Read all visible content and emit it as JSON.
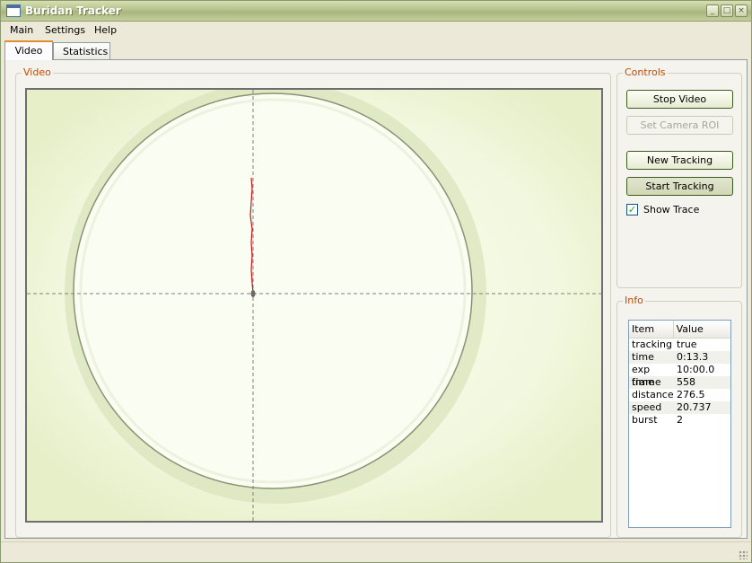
{
  "window": {
    "title": "Buridan Tracker"
  },
  "menu": {
    "items": [
      "Main",
      "Settings",
      "Help"
    ]
  },
  "tabs": [
    {
      "label": "Video",
      "active": true
    },
    {
      "label": "Statistics",
      "active": false
    }
  ],
  "video_group": {
    "title": "Video"
  },
  "controls": {
    "title": "Controls",
    "stop_video": "Stop Video",
    "set_camera_roi": "Set Camera ROI",
    "new_tracking": "New Tracking",
    "start_tracking": "Start Tracking",
    "show_trace_label": "Show Trace",
    "show_trace_checked": true
  },
  "info": {
    "title": "Info",
    "columns": [
      "Item",
      "Value"
    ],
    "rows": [
      [
        "tracking",
        "true"
      ],
      [
        "time",
        "0:13.3"
      ],
      [
        "exp time",
        "10:00.0"
      ],
      [
        "frame",
        "558"
      ],
      [
        "distance",
        "276.5"
      ],
      [
        "speed",
        "20.737"
      ],
      [
        "burst",
        "2"
      ]
    ]
  },
  "colors": {
    "accent_orange": "#e68b2c",
    "group_title": "#c44a00",
    "trace": "#cc1111",
    "arena_bg": "#eef6d8"
  }
}
